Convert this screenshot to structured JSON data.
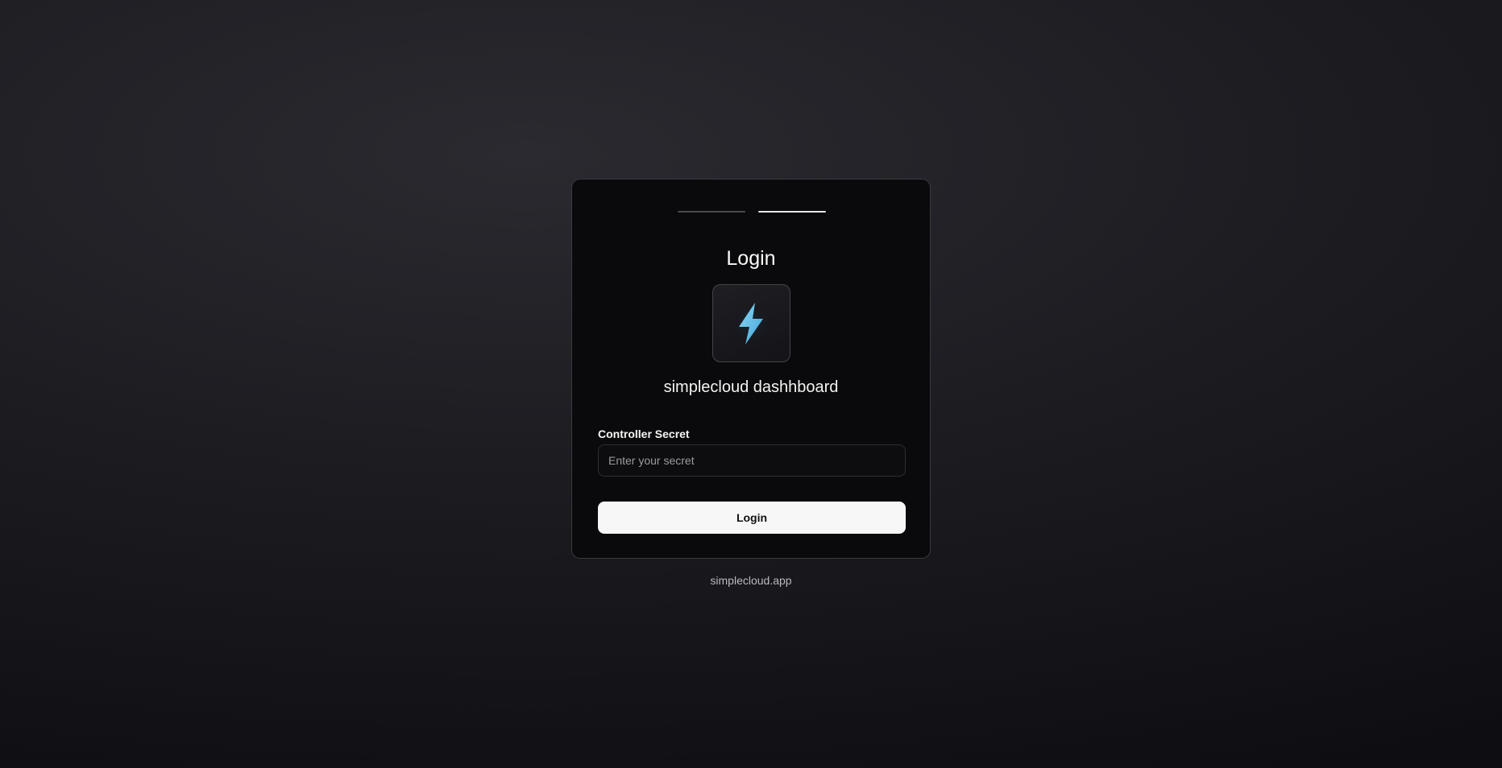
{
  "login": {
    "title": "Login",
    "brand_name": "simplecloud dashhboard",
    "logo_icon": "lightning-bolt-icon",
    "accent_color": "#5bbde6",
    "field_label": "Controller Secret",
    "field_placeholder": "Enter your secret",
    "field_value": "",
    "submit_label": "Login",
    "steps": {
      "total": 2,
      "current": 2
    }
  },
  "footer": {
    "text": "simplecloud.app"
  }
}
